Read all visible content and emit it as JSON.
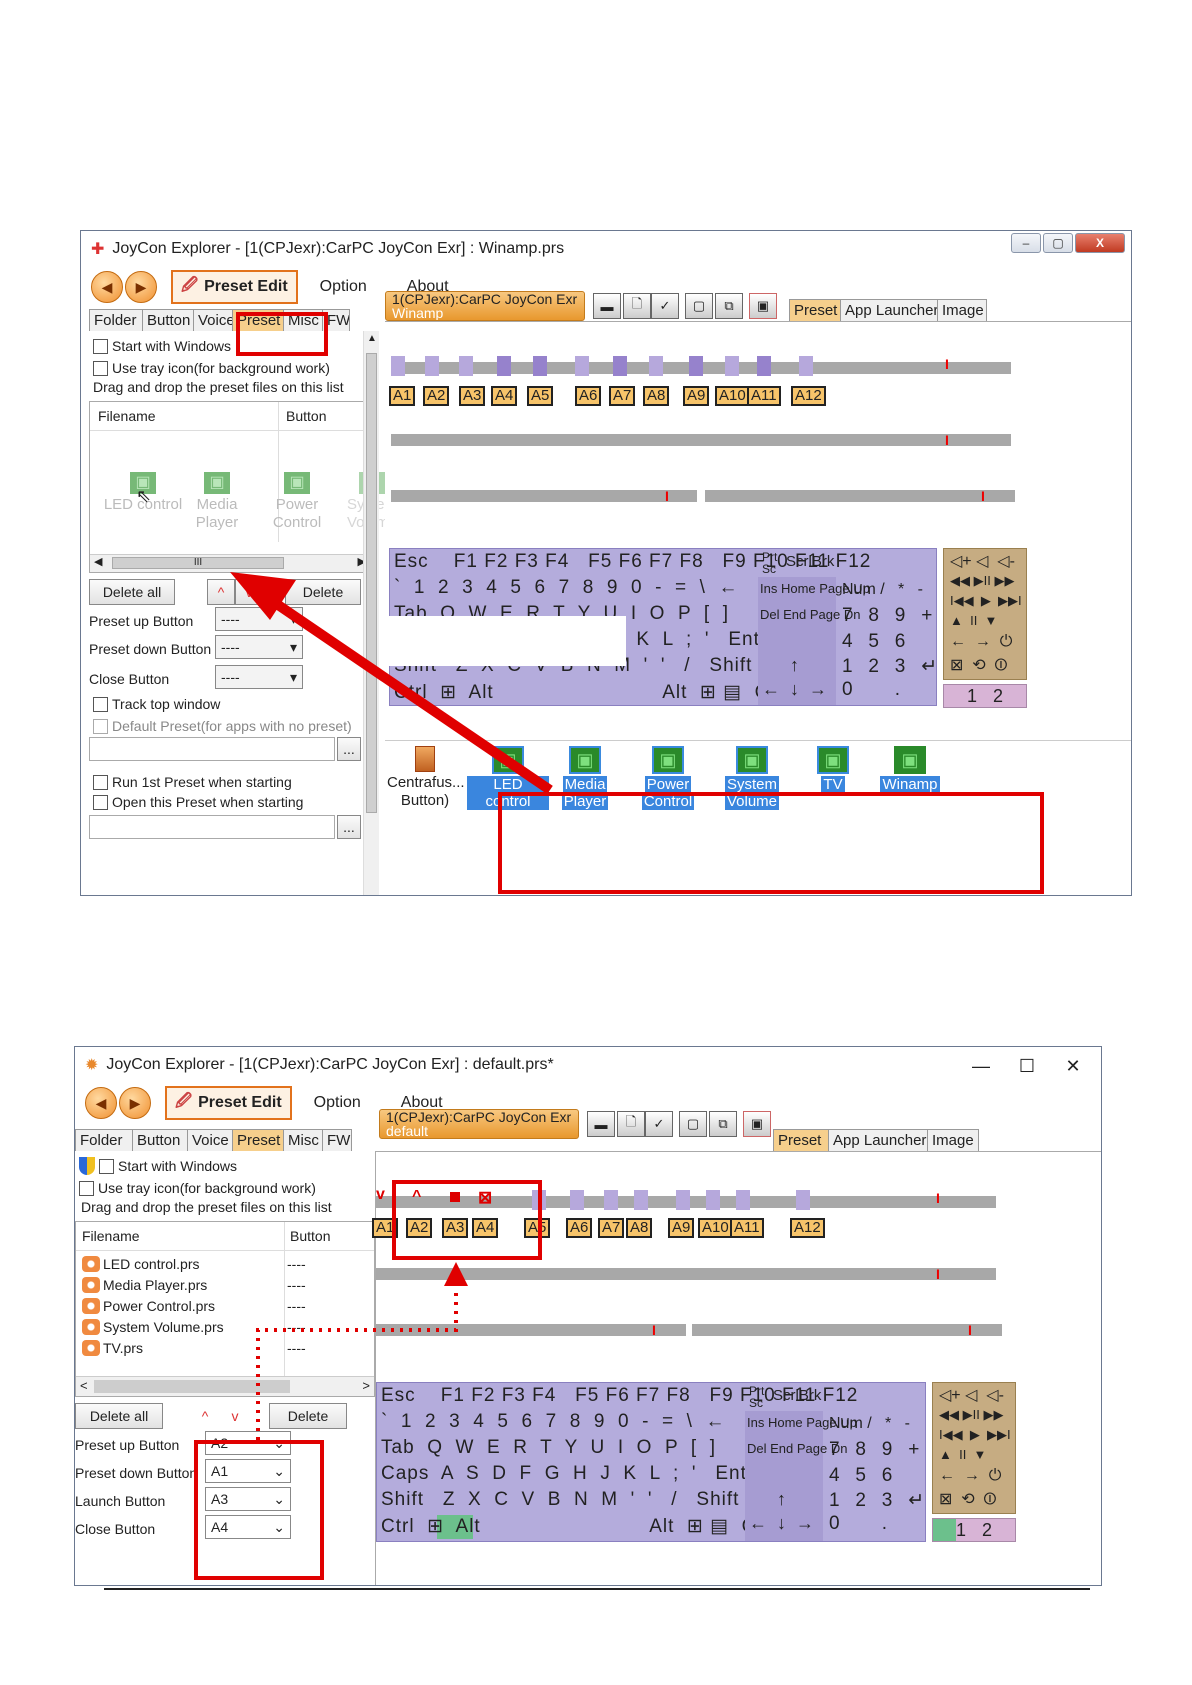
{
  "window1": {
    "title": "JoyCon Explorer - [1(CPJexr):CarPC JoyCon Exr] : Winamp.prs",
    "menu": {
      "preset_edit": "Preset Edit",
      "option": "Option",
      "about": "About"
    },
    "left_tabs": [
      "Folder",
      "Button",
      "Voice",
      "Preset",
      "Misc",
      "FW"
    ],
    "start_with_windows": "Start with Windows",
    "use_tray_icon": "Use tray icon(for background work)",
    "drag_drop_hint": "Drag and drop the preset files on this list",
    "list_headers": {
      "filename": "Filename",
      "button": "Button"
    },
    "ghost_items": [
      {
        "l1": "LED control",
        "l2": ""
      },
      {
        "l1": "Media",
        "l2": "Player"
      },
      {
        "l1": "Power",
        "l2": "Control"
      },
      {
        "l1": "System",
        "l2": "Volume"
      }
    ],
    "scroll_thumb": "III",
    "delete_all": "Delete all",
    "delete": "Delete",
    "preset_up_button": "Preset up Button",
    "preset_down_button": "Preset down Button",
    "close_button": "Close Button",
    "dash": "----",
    "track_top_window": "Track top window",
    "default_preset": "Default Preset(for apps with no preset)",
    "run_first_preset": "Run 1st Preset when starting",
    "open_this_preset": "Open this Preset when starting",
    "ellipsis": "...",
    "device": {
      "line1": "1(CPJexr):CarPC JoyCon Exr",
      "line2": "Winamp"
    },
    "right_tabs": [
      "Preset",
      "App Launcher",
      "Image"
    ],
    "a_labels": [
      "A1",
      "A2",
      "A3",
      "A4",
      "A5",
      "A6",
      "A7",
      "A8",
      "A9",
      "A10",
      "A11",
      "A12"
    ],
    "centrafuse": {
      "l1": "Centrafus...",
      "l2": "Button)"
    },
    "presets": [
      {
        "l1": "LED control",
        "l2": ""
      },
      {
        "l1": "Media",
        "l2": "Player"
      },
      {
        "l1": "Power",
        "l2": "Control"
      },
      {
        "l1": "System",
        "l2": "Volume"
      },
      {
        "l1": "TV",
        "l2": ""
      },
      {
        "l1": "Winamp",
        "l2": ""
      }
    ]
  },
  "window2": {
    "title": "JoyCon Explorer - [1(CPJexr):CarPC JoyCon Exr] : default.prs*",
    "menu": {
      "preset_edit": "Preset Edit",
      "option": "Option",
      "about": "About"
    },
    "left_tabs": [
      "Folder",
      "Button",
      "Voice",
      "Preset",
      "Misc",
      "FW"
    ],
    "start_with_windows": "Start with Windows",
    "use_tray_icon": "Use tray icon(for background work)",
    "drag_drop_hint": "Drag and drop the preset files on this list",
    "list_headers": {
      "filename": "Filename",
      "button": "Button"
    },
    "files": [
      {
        "name": "LED control.prs",
        "button": "----"
      },
      {
        "name": "Media Player.prs",
        "button": "----"
      },
      {
        "name": "Power Control.prs",
        "button": "----"
      },
      {
        "name": "System Volume.prs",
        "button": "----"
      },
      {
        "name": "TV.prs",
        "button": "----"
      }
    ],
    "delete_all": "Delete all",
    "delete": "Delete",
    "fields": [
      {
        "label": "Preset up Button",
        "value": "A2"
      },
      {
        "label": "Preset down Button",
        "value": "A1"
      },
      {
        "label": "Launch Button",
        "value": "A3"
      },
      {
        "label": "Close Button",
        "value": "A4"
      }
    ],
    "device": {
      "line1": "1(CPJexr):CarPC JoyCon Exr",
      "line2": "default"
    },
    "right_tabs": [
      "Preset",
      "App Launcher",
      "Image"
    ],
    "a_labels": [
      "A1",
      "A2",
      "A3",
      "A4",
      "A5",
      "A6",
      "A7",
      "A8",
      "A9",
      "A10",
      "A11",
      "A12"
    ]
  },
  "keyboard": {
    "row1": "Esc    F1 F2 F3 F4   F5 F6 F7 F8   F9 F10 F11 F12",
    "prt": "Prt Sc",
    "scrlbrk": "ScrlBrk",
    "row2": "`  1  2  3  4  5  6  7  8  9  0  -  =  \\  ←",
    "row3": "Tab  Q  W  E  R  T  Y  U  I  O  P  [  ]",
    "row4": "Caps  A  S  D  F  G  H  J  K  L  ;  '   Enter",
    "row5": "Shift   Z  X  C  V  B  N  M  '  '   /   Shift",
    "row6": "Ctrl        Alt                              Alt          Ctrl",
    "row6_alt": "Ctrl  ⊞  Alt                           Alt  ⊞ ▤  Ctrl",
    "nav1": "Ins  Home  Page Up",
    "nav2": "Del  End  Page Dn",
    "nav3": "↑",
    "nav4": "←  ↓  →",
    "num1": "Num /   *   -",
    "num2": "7   8   9   +",
    "num3": "4   5   6",
    "num4": "1   2   3   ↵",
    "num5": "0        .",
    "media1": "◁+ ◁  ◁-",
    "media2": "◀◀ ▶II ▶▶",
    "media3": "I◀◀  ▶  ▶▶I",
    "media4": "▲  II  ▼",
    "media5": "←  →  ⏻",
    "media6": "⊠  ⟲  ⏼",
    "pages": [
      "1",
      "2"
    ]
  }
}
